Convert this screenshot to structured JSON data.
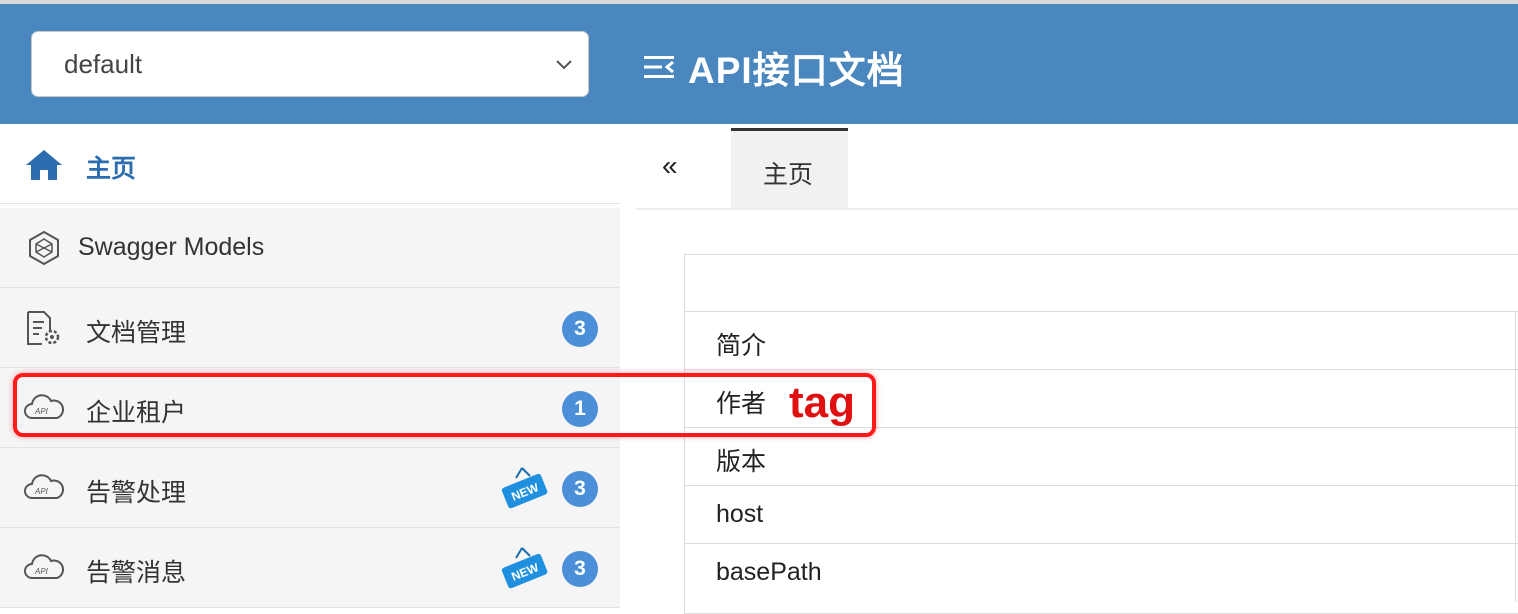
{
  "header": {
    "group_select": "default",
    "title": "API接口文档"
  },
  "sidebar": {
    "items": [
      {
        "label": "主页",
        "icon": "home-icon"
      },
      {
        "label": "Swagger Models",
        "icon": "swagger-models-icon"
      },
      {
        "label": "文档管理",
        "icon": "document-settings-icon",
        "count": "3"
      },
      {
        "label": "企业租户",
        "icon": "api-cloud-icon",
        "count": "1"
      },
      {
        "label": "告警处理",
        "icon": "api-cloud-icon",
        "count": "3",
        "new": "NEW"
      },
      {
        "label": "告警消息",
        "icon": "api-cloud-icon",
        "count": "3",
        "new": "NEW"
      }
    ]
  },
  "annotation": {
    "label": "tag",
    "color": "#ff1a1a"
  },
  "tabs": {
    "collapse": "«",
    "active": "主页"
  },
  "info_table": {
    "rows": [
      "简介",
      "作者",
      "版本",
      "host",
      "basePath"
    ]
  },
  "colors": {
    "header_bg": "#4a87bf",
    "badge": "#4a8fd8",
    "home_active": "#2c6db0"
  }
}
